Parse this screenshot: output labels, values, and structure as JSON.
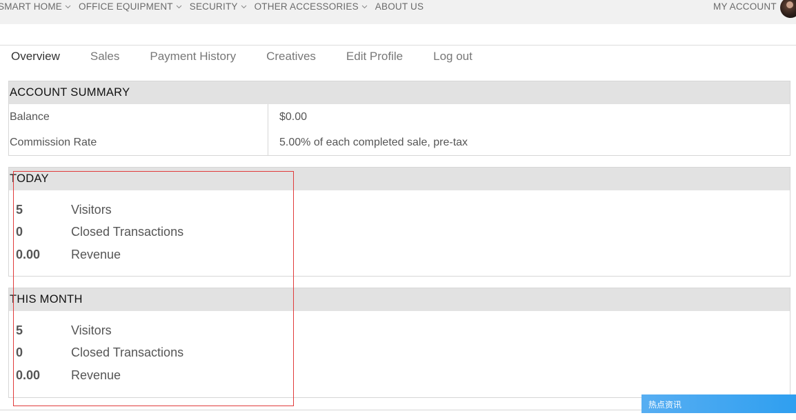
{
  "topnav": {
    "menu": [
      {
        "label": "SMART HOME",
        "has_dropdown": true
      },
      {
        "label": "OFFICE EQUIPMENT",
        "has_dropdown": true
      },
      {
        "label": "SECURITY",
        "has_dropdown": true
      },
      {
        "label": "OTHER ACCESSORIES",
        "has_dropdown": true
      },
      {
        "label": "ABOUT US",
        "has_dropdown": false
      }
    ],
    "account_label": "MY ACCOUNT"
  },
  "tabs": [
    {
      "label": "Overview",
      "active": true
    },
    {
      "label": "Sales",
      "active": false
    },
    {
      "label": "Payment History",
      "active": false
    },
    {
      "label": "Creatives",
      "active": false
    },
    {
      "label": "Edit Profile",
      "active": false
    },
    {
      "label": "Log out",
      "active": false
    }
  ],
  "account_summary": {
    "title": "ACCOUNT SUMMARY",
    "rows": [
      {
        "key": "Balance",
        "value": "$0.00"
      },
      {
        "key": "Commission Rate",
        "value": "5.00% of each completed sale, pre-tax"
      }
    ]
  },
  "today": {
    "title": "TODAY",
    "stats": [
      {
        "value": "5",
        "label": "Visitors"
      },
      {
        "value": "0",
        "label": "Closed Transactions"
      },
      {
        "value": "0.00",
        "label": "Revenue"
      }
    ]
  },
  "this_month": {
    "title": "THIS MONTH",
    "stats": [
      {
        "value": "5",
        "label": "Visitors"
      },
      {
        "value": "0",
        "label": "Closed Transactions"
      },
      {
        "value": "0.00",
        "label": "Revenue"
      }
    ]
  },
  "hot_news": {
    "title": "热点资讯"
  },
  "colors": {
    "panel_header_bg": "#e2e2e2",
    "selection_border": "#e03a3a",
    "hot_news_bg": "#2f9ff0"
  }
}
